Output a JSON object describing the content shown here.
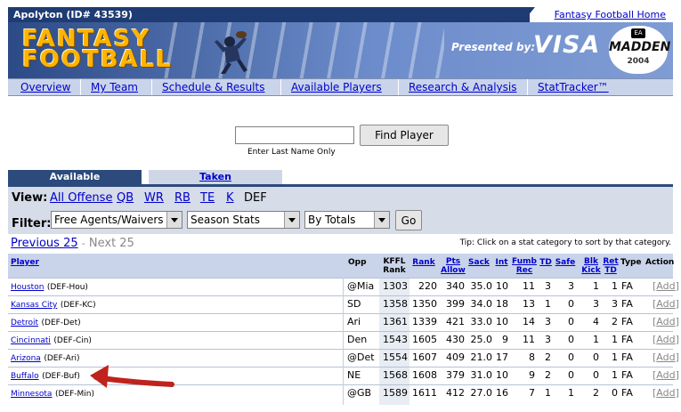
{
  "topbar": {
    "team_name": "Apolyton (ID# 43539)",
    "home_link": "Fantasy Football Home"
  },
  "banner": {
    "logo_line1": "FANTASY",
    "logo_line2": "FOOTBALL",
    "presented": "Presented by:",
    "visa": "VISA",
    "ea": "EA",
    "madden": "MADDEN",
    "madden_year": "2004"
  },
  "nav": [
    "Overview",
    "My Team",
    "Schedule & Results",
    "Available Players",
    "Research & Analysis",
    "StatTracker™"
  ],
  "search": {
    "value": "",
    "button": "Find Player",
    "hint": "Enter Last Name Only"
  },
  "tabs": {
    "available": "Available",
    "taken": "Taken"
  },
  "view": {
    "label": "View:",
    "options": [
      "All Offense",
      "QB",
      "WR",
      "RB",
      "TE",
      "K"
    ],
    "current": "DEF"
  },
  "filter": {
    "label": "Filter:",
    "player_pool": "Free Agents/Waivers",
    "stat_type": "Season Stats",
    "sort_mode": "By Totals",
    "go": "Go"
  },
  "pager": {
    "prev": "Previous 25",
    "dash": "-",
    "next": "Next 25",
    "tip": "Tip: Click on a stat category to sort by that category."
  },
  "table": {
    "headers": {
      "player": "Player",
      "opp": "Opp",
      "kffl1": "KFFL",
      "kffl2": "Rank",
      "rank": "Rank",
      "pts1": "Pts",
      "pts2": "Allow",
      "sack": "Sack",
      "int": "Int",
      "fumb1": "Fumb",
      "fumb2": "Rec",
      "td": "TD",
      "safe": "Safe",
      "blk1": "Blk",
      "blk2": "Kick",
      "ret1": "Ret",
      "ret2": "TD",
      "type": "Type",
      "action": "Action"
    },
    "rows": [
      {
        "team": "Houston",
        "pos": "(DEF-Hou)",
        "opp": "@Mia",
        "kffl": "1303",
        "rank": "220",
        "pts": "340",
        "sack": "35.0",
        "int": "10",
        "fumb": "11",
        "td": "3",
        "safe": "3",
        "blk": "1",
        "ret": "1",
        "type": "FA",
        "lb": "[",
        "add": "Add",
        "rb": "]"
      },
      {
        "team": "Kansas City",
        "pos": "(DEF-KC)",
        "opp": "SD",
        "kffl": "1358",
        "rank": "1350",
        "pts": "399",
        "sack": "34.0",
        "int": "18",
        "fumb": "13",
        "td": "1",
        "safe": "0",
        "blk": "3",
        "ret": "3",
        "type": "FA",
        "lb": "[",
        "add": "Add",
        "rb": "]"
      },
      {
        "team": "Detroit",
        "pos": "(DEF-Det)",
        "opp": "Ari",
        "kffl": "1361",
        "rank": "1339",
        "pts": "421",
        "sack": "33.0",
        "int": "10",
        "fumb": "14",
        "td": "3",
        "safe": "0",
        "blk": "4",
        "ret": "2",
        "type": "FA",
        "lb": "[",
        "add": "Add",
        "rb": "]"
      },
      {
        "team": "Cincinnati",
        "pos": "(DEF-Cin)",
        "opp": "Den",
        "kffl": "1543",
        "rank": "1605",
        "pts": "430",
        "sack": "25.0",
        "int": "9",
        "fumb": "11",
        "td": "3",
        "safe": "0",
        "blk": "1",
        "ret": "1",
        "type": "FA",
        "lb": "[",
        "add": "Add",
        "rb": "]"
      },
      {
        "team": "Arizona",
        "pos": "(DEF-Ari)",
        "opp": "@Det",
        "kffl": "1554",
        "rank": "1607",
        "pts": "409",
        "sack": "21.0",
        "int": "17",
        "fumb": "8",
        "td": "2",
        "safe": "0",
        "blk": "0",
        "ret": "1",
        "type": "FA",
        "lb": "[",
        "add": "Add",
        "rb": "]"
      },
      {
        "team": "Buffalo",
        "pos": "(DEF-Buf)",
        "opp": "NE",
        "kffl": "1568",
        "rank": "1608",
        "pts": "379",
        "sack": "31.0",
        "int": "10",
        "fumb": "9",
        "td": "2",
        "safe": "0",
        "blk": "0",
        "ret": "1",
        "type": "FA",
        "lb": "[",
        "add": "Add",
        "rb": "]"
      },
      {
        "team": "Minnesota",
        "pos": "(DEF-Min)",
        "opp": "@GB",
        "kffl": "1589",
        "rank": "1611",
        "pts": "412",
        "sack": "27.0",
        "int": "16",
        "fumb": "7",
        "td": "1",
        "safe": "1",
        "blk": "2",
        "ret": "0",
        "type": "FA",
        "lb": "[",
        "add": "Add",
        "rb": "]"
      }
    ]
  },
  "colors": {
    "navy": "#1f3b73",
    "tab_active": "#2c4a7c",
    "nav_bg": "#c9d4ea",
    "filter_bg": "#d6dce8",
    "link": "#0000cc",
    "annotation_arrow": "#c0221c"
  },
  "icons": {
    "annotation": "red-arrow-icon",
    "dropdown": "chevron-down-icon",
    "player": "football-player-icon"
  }
}
